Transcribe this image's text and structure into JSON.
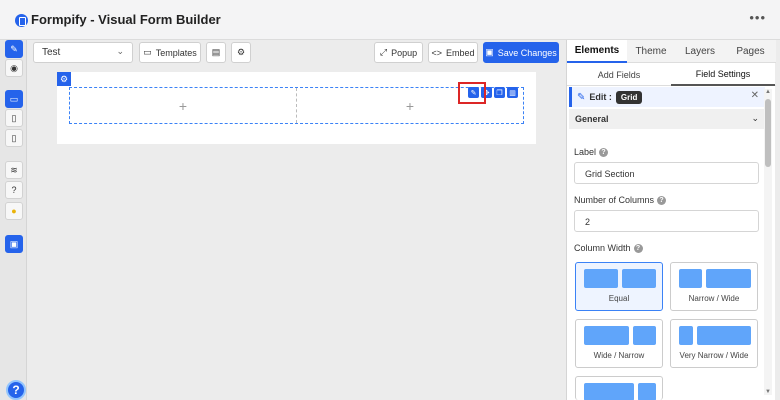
{
  "app": {
    "title": "Formpify - Visual Form Builder",
    "menu_icon": "ellipsis-icon"
  },
  "toolbar": {
    "form_select": "Test",
    "templates_label": "Templates",
    "popup_label": "Popup",
    "embed_label": "Embed",
    "save_label": "Save Changes"
  },
  "left_toolbar": {
    "icons": [
      "edit-icon",
      "eye-icon",
      "desktop-icon",
      "tablet-icon",
      "mobile-icon",
      "layers-icon",
      "help-icon",
      "lightbulb-icon",
      "save-icon"
    ],
    "help_label": "?"
  },
  "canvas": {
    "grid_plus": [
      "+",
      "+"
    ]
  },
  "panel": {
    "tabs": [
      "Elements",
      "Theme",
      "Layers",
      "Pages"
    ],
    "active_tab": "Elements",
    "subtabs": [
      "Add Fields",
      "Field Settings"
    ],
    "active_subtab": "Field Settings",
    "edit_label": "Edit :",
    "edit_type": "Grid",
    "section_title": "General",
    "label_title": "Label",
    "label_value": "Grid Section",
    "columns_title": "Number of Columns",
    "columns_value": "2",
    "column_width_title": "Column Width",
    "column_width_options": [
      "Equal",
      "Narrow / Wide",
      "Wide / Narrow",
      "Very Narrow / Wide"
    ],
    "selected_option": "Equal"
  },
  "colors": {
    "accent": "#2563eb",
    "highlight": "#dc2626",
    "bar": "#60a5fa"
  }
}
